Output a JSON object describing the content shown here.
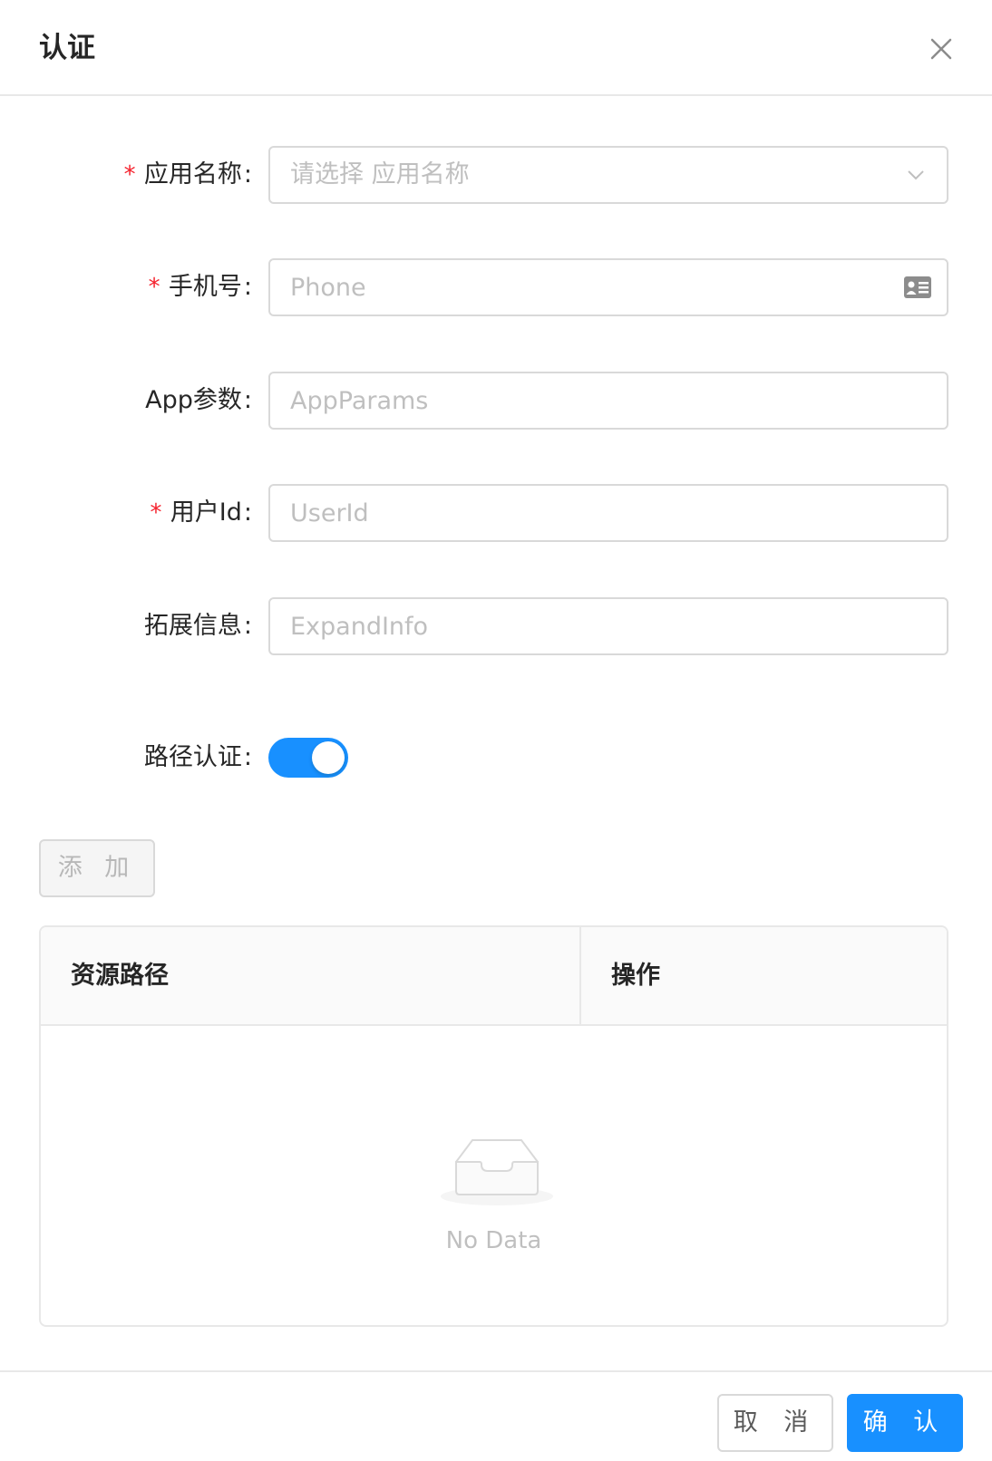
{
  "modal": {
    "title": "认证"
  },
  "form": {
    "app_name": {
      "required_mark": "*",
      "label": "应用名称",
      "colon": ":",
      "placeholder": "请选择 应用名称"
    },
    "phone": {
      "required_mark": "*",
      "label": "手机号",
      "colon": ":",
      "placeholder": "Phone",
      "suffix_icon": "contact-card-icon"
    },
    "app_params": {
      "label": "App参数",
      "colon": ":",
      "placeholder": "AppParams"
    },
    "user_id": {
      "required_mark": "*",
      "label": "用户Id",
      "colon": ":",
      "placeholder": "UserId"
    },
    "expand_info": {
      "label": "拓展信息",
      "colon": ":",
      "placeholder": "ExpandInfo"
    },
    "path_auth": {
      "label": "路径认证",
      "colon": ":",
      "enabled": true
    }
  },
  "add_button": {
    "label": "添 加"
  },
  "table": {
    "columns": [
      "资源路径",
      "操作"
    ],
    "empty_text": "No Data"
  },
  "footer": {
    "cancel_label": "取 消",
    "ok_label": "确 认"
  },
  "colors": {
    "primary": "#1890ff",
    "required": "#f5222d"
  }
}
